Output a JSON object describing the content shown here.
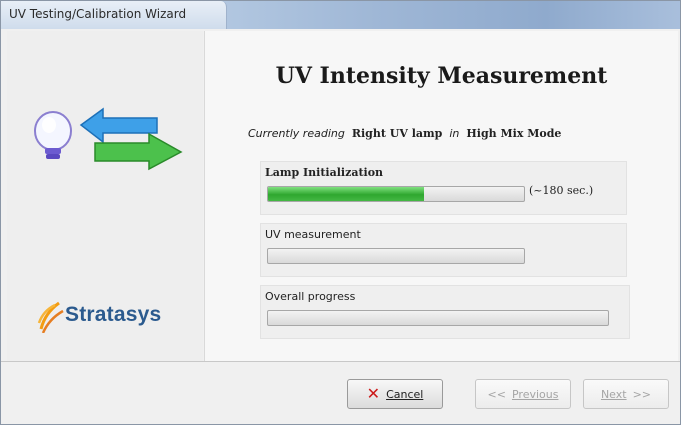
{
  "window": {
    "title": "UV Testing/Calibration Wizard"
  },
  "branding": {
    "logo_text": "Stratasys",
    "logo_color": "#2b5a8e"
  },
  "page": {
    "heading": "UV Intensity Measurement",
    "reading": {
      "prefix": "Currently reading",
      "lamp": "Right UV lamp",
      "joiner": "in",
      "mode": "High Mix Mode"
    }
  },
  "sections": {
    "lamp_init": {
      "label": "Lamp Initialization",
      "progress": 0.61,
      "time": "(~180 sec.)"
    },
    "uv_measurement": {
      "label": "UV measurement",
      "progress": 0
    },
    "overall": {
      "label": "Overall progress",
      "progress": 0
    }
  },
  "buttons": {
    "cancel": {
      "label": "Cancel",
      "icon": "cancel-x-icon"
    },
    "previous": {
      "label": "Previous",
      "icon": "chevron-left-icon",
      "enabled": false
    },
    "next": {
      "label": "Next",
      "icon": "chevron-right-icon",
      "enabled": false
    }
  },
  "colors": {
    "progress_fill": "#2fa72f",
    "cancel_icon": "#cc1a1a"
  }
}
